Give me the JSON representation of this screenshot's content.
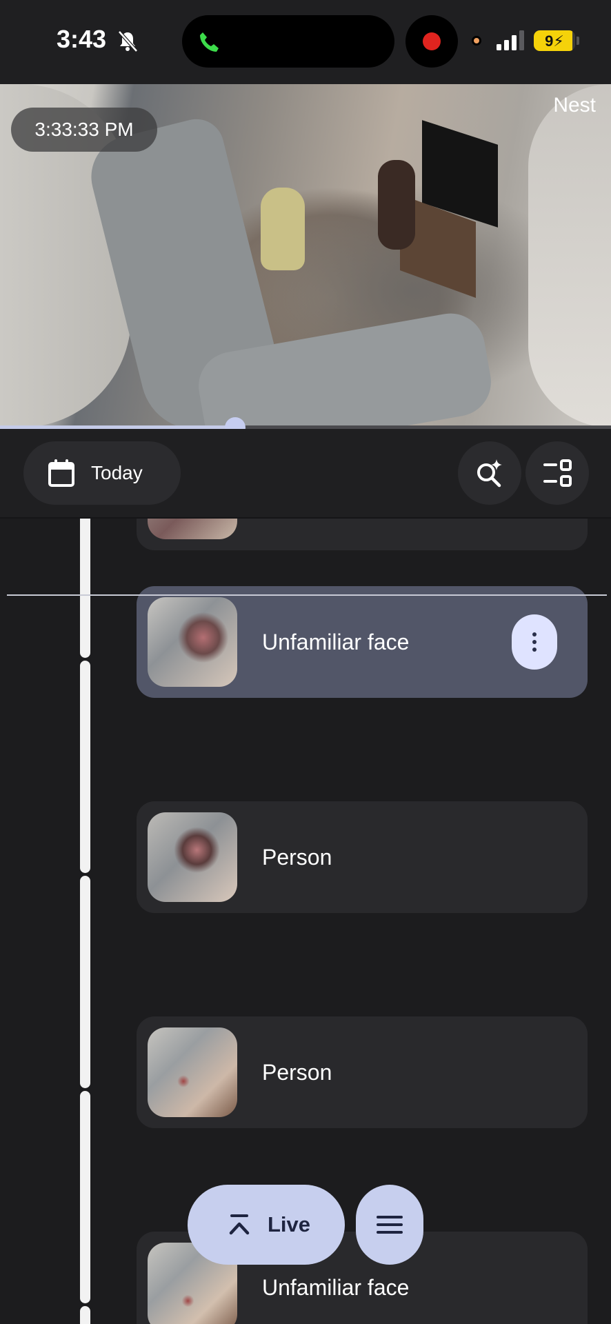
{
  "status_bar": {
    "time": "3:43",
    "battery_level": "94",
    "battery_label": "9⚡"
  },
  "camera": {
    "brand": "Nest",
    "timestamp": "3:33:33 PM",
    "scrubber_position": 0.385
  },
  "toolbar": {
    "date_label": "Today"
  },
  "timeline": {
    "events": [
      {
        "label": "",
        "active": false
      },
      {
        "label": "Unfamiliar face",
        "active": true
      },
      {
        "label": "Person",
        "active": false
      },
      {
        "label": "Person",
        "active": false
      },
      {
        "label": "Unfamiliar face",
        "active": false
      }
    ]
  },
  "floating": {
    "live_label": "Live"
  },
  "colors": {
    "accent": "#c7cfee",
    "active_card": "#525668",
    "recording": "#e0241f",
    "battery": "#f5d20a"
  }
}
